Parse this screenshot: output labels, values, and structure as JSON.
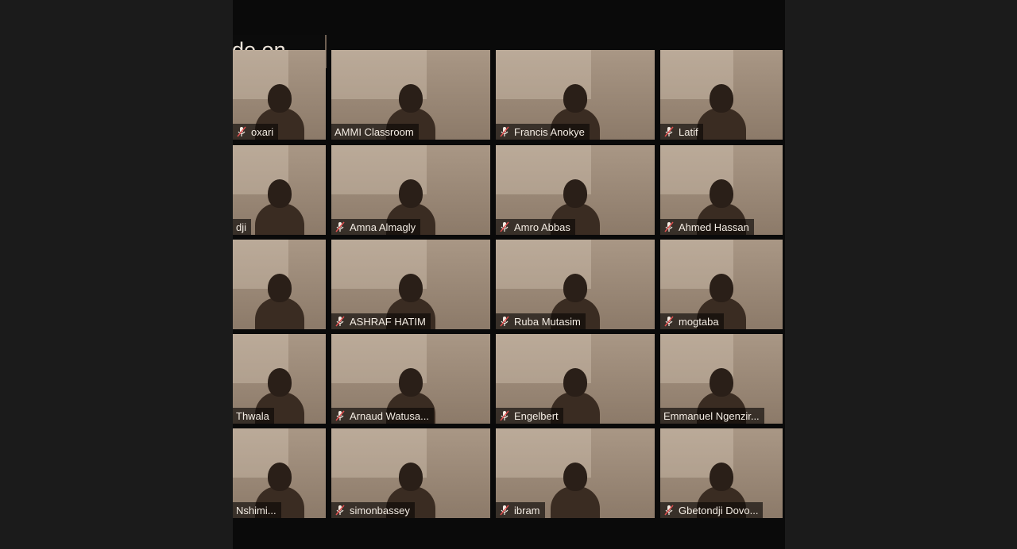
{
  "banner": {
    "text": "ode on"
  },
  "tiles": [
    {
      "name": "oxari",
      "mic_icon": "mic-muted-icon"
    },
    {
      "name": "AMMI Classroom",
      "mic_icon": ""
    },
    {
      "name": "Francis Anokye",
      "mic_icon": "mic-muted-icon"
    },
    {
      "name": "Latif",
      "mic_icon": "mic-muted-icon"
    },
    {
      "name": "dji",
      "mic_icon": ""
    },
    {
      "name": "Amna Almagly",
      "mic_icon": "mic-muted-icon"
    },
    {
      "name": "Amro Abbas",
      "mic_icon": "mic-muted-icon"
    },
    {
      "name": "Ahmed Hassan",
      "mic_icon": "mic-muted-icon"
    },
    {
      "name": "",
      "mic_icon": ""
    },
    {
      "name": "ASHRAF HATIM",
      "mic_icon": "mic-muted-icon"
    },
    {
      "name": "Ruba Mutasim",
      "mic_icon": "mic-muted-icon"
    },
    {
      "name": "mogtaba",
      "mic_icon": "mic-muted-icon"
    },
    {
      "name": "Thwala",
      "mic_icon": ""
    },
    {
      "name": "Arnaud Watusa...",
      "mic_icon": "mic-muted-icon"
    },
    {
      "name": "Engelbert",
      "mic_icon": "mic-muted-icon"
    },
    {
      "name": "Emmanuel Ngenzir...",
      "mic_icon": ""
    },
    {
      "name": "Nshimi...",
      "mic_icon": ""
    },
    {
      "name": "simonbassey",
      "mic_icon": "mic-muted-icon"
    },
    {
      "name": "ibram",
      "mic_icon": "mic-muted-icon"
    },
    {
      "name": "Gbetondji Dovo...",
      "mic_icon": "mic-muted-icon"
    }
  ]
}
